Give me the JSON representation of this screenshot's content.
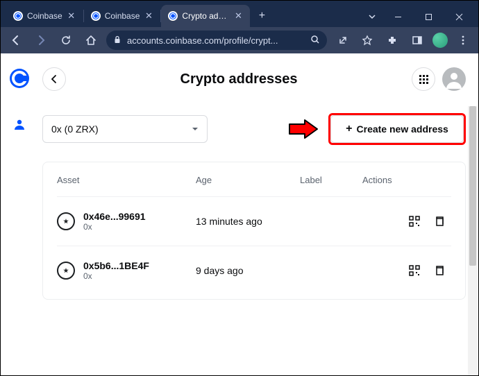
{
  "browser": {
    "tabs": [
      {
        "title": "Coinbase",
        "active": false
      },
      {
        "title": "Coinbase",
        "active": false
      },
      {
        "title": "Crypto addre",
        "active": true
      }
    ],
    "url": "accounts.coinbase.com/profile/crypt..."
  },
  "page": {
    "title": "Crypto addresses",
    "dropdown_value": "0x (0 ZRX)",
    "create_label": "Create new address",
    "table": {
      "headers": {
        "asset": "Asset",
        "age": "Age",
        "label": "Label",
        "actions": "Actions"
      },
      "rows": [
        {
          "hash": "0x46e...99691",
          "sym": "0x",
          "age": "13 minutes ago"
        },
        {
          "hash": "0x5b6...1BE4F",
          "sym": "0x",
          "age": "9 days ago"
        }
      ]
    }
  }
}
